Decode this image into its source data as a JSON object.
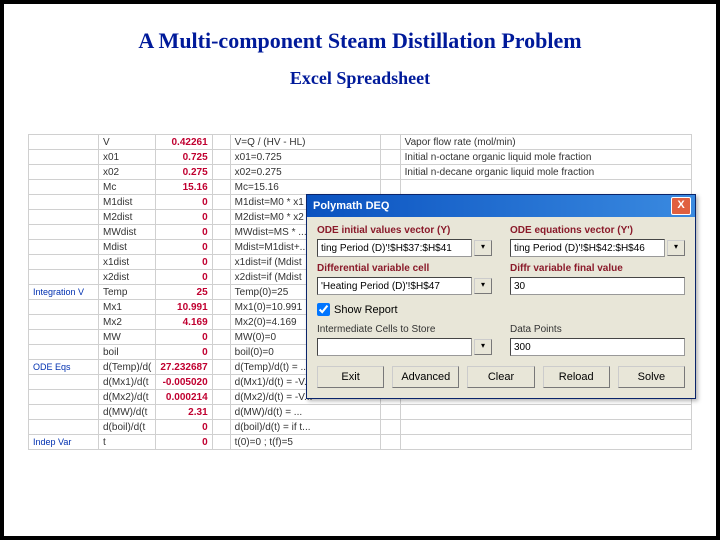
{
  "titles": {
    "main": "A Multi-component Steam Distillation Problem",
    "sub": "Excel Spreadsheet"
  },
  "sections": {
    "integration": "Integration V",
    "ode_eqs": "ODE Eqs",
    "indep_var": "Indep Var"
  },
  "sheet_rows": [
    {
      "b": "V",
      "c": "0.42261",
      "e": "V=Q / (HV - HL)",
      "g": "Vapor flow rate (mol/min)"
    },
    {
      "b": "x01",
      "c": "0.725",
      "e": "x01=0.725",
      "g": "Initial n-octane organic liquid mole fraction"
    },
    {
      "b": "x02",
      "c": "0.275",
      "e": "x02=0.275",
      "g": "Initial n-decane organic liquid mole fraction"
    },
    {
      "b": "Mc",
      "c": "15.16",
      "e": "Mc=15.16",
      "g": ""
    },
    {
      "b": "M1dist",
      "c": "0",
      "e": "M1dist=M0 * x1",
      "g": ""
    },
    {
      "b": "M2dist",
      "c": "0",
      "e": "M2dist=M0 * x2",
      "g": ""
    },
    {
      "b": "MWdist",
      "c": "0",
      "e": "MWdist=MS * ...",
      "g": ""
    },
    {
      "b": "Mdist",
      "c": "0",
      "e": "Mdist=M1dist+...",
      "g": ""
    },
    {
      "b": "x1dist",
      "c": "0",
      "e": "x1dist=if (Mdist",
      "g": ""
    },
    {
      "b": "x2dist",
      "c": "0",
      "e": "x2dist=if (Mdist",
      "g": ""
    },
    {
      "a": "Integration V",
      "b": "Temp",
      "c": "25",
      "e": "Temp(0)=25",
      "g": ""
    },
    {
      "b": "Mx1",
      "c": "10.991",
      "e": "Mx1(0)=10.991",
      "g": ""
    },
    {
      "b": "Mx2",
      "c": "4.169",
      "e": "Mx2(0)=4.169",
      "g": ""
    },
    {
      "b": "MW",
      "c": "0",
      "e": "MW(0)=0",
      "g": ""
    },
    {
      "b": "boil",
      "c": "0",
      "e": "boil(0)=0",
      "g": ""
    },
    {
      "a": "ODE Eqs",
      "b": "d(Temp)/d(",
      "c": "27.232687",
      "e": "d(Temp)/d(t) = ...",
      "g": ""
    },
    {
      "b": "d(Mx1)/d(t",
      "c": "-0.005020",
      "e": "d(Mx1)/d(t) = -V...",
      "g": ""
    },
    {
      "b": "d(Mx2)/d(t",
      "c": "0.000214",
      "e": "d(Mx2)/d(t) = -V...",
      "g": ""
    },
    {
      "b": "d(MW)/d(t",
      "c": "2.31",
      "e": "d(MW)/d(t) = ...",
      "g": ""
    },
    {
      "b": "d(boil)/d(t",
      "c": "0",
      "e": "d(boil)/d(t) = if t...",
      "g": ""
    },
    {
      "a": "Indep Var",
      "b": "t",
      "c": "0",
      "e": "t(0)=0 ; t(f)=5",
      "g": ""
    }
  ],
  "dialog": {
    "title": "Polymath DEQ",
    "close": "X",
    "labels": {
      "y_vec": "ODE initial values vector (Y)",
      "yp_vec": "ODE equations vector (Y')",
      "diff_cell": "Differential variable cell",
      "diff_final": "Diffr variable final value",
      "show_report": "Show Report",
      "interm_cells": "Intermediate Cells to Store",
      "data_points": "Data Points"
    },
    "values": {
      "y_vec": "ting Period (D)'!$H$37:$H$41",
      "yp_vec": "ting Period (D)'!$H$42:$H$46",
      "diff_cell": "'Heating Period (D)'!$H$47",
      "diff_final": "30",
      "interm_cells": "",
      "data_points": "300",
      "show_report_checked": true
    },
    "buttons": {
      "exit": "Exit",
      "advanced": "Advanced",
      "clear": "Clear",
      "reload": "Reload",
      "solve": "Solve"
    }
  }
}
